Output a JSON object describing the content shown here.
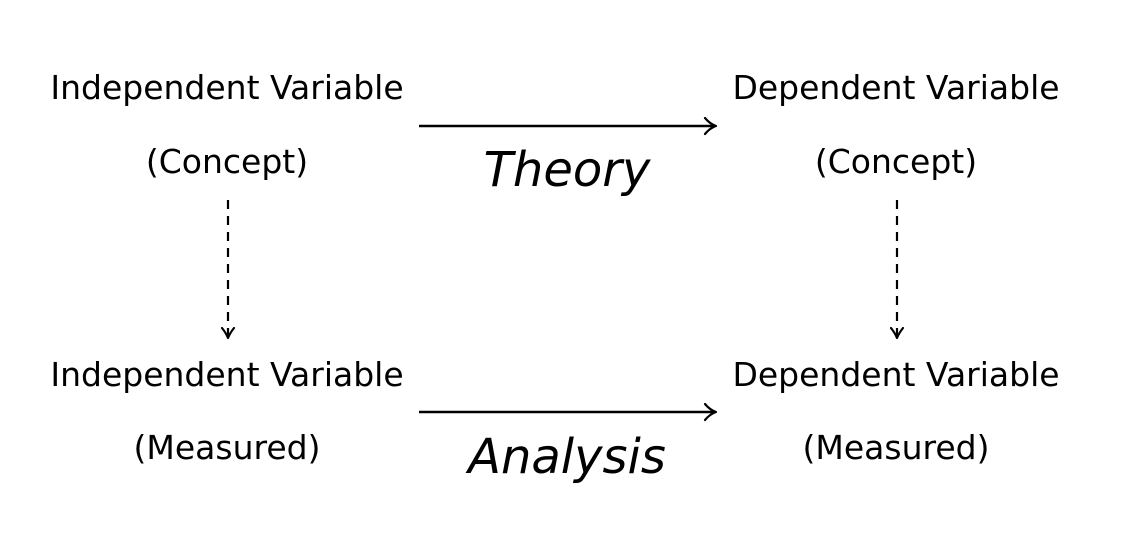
{
  "diagram": {
    "nodes": {
      "iv_concept": {
        "line1": "Independent Variable",
        "line2": "(Concept)"
      },
      "dv_concept": {
        "line1": "Dependent Variable",
        "line2": "(Concept)"
      },
      "iv_measured": {
        "line1": "Independent Variable",
        "line2": "(Measured)"
      },
      "dv_measured": {
        "line1": "Dependent Variable",
        "line2": "(Measured)"
      }
    },
    "edges": {
      "theory": {
        "label": "Theory",
        "style": "solid"
      },
      "analysis": {
        "label": "Analysis",
        "style": "solid"
      },
      "iv_operationalize": {
        "style": "dashed"
      },
      "dv_operationalize": {
        "style": "dashed"
      }
    },
    "colors": {
      "ink": "#000000",
      "background": "#ffffff"
    }
  }
}
